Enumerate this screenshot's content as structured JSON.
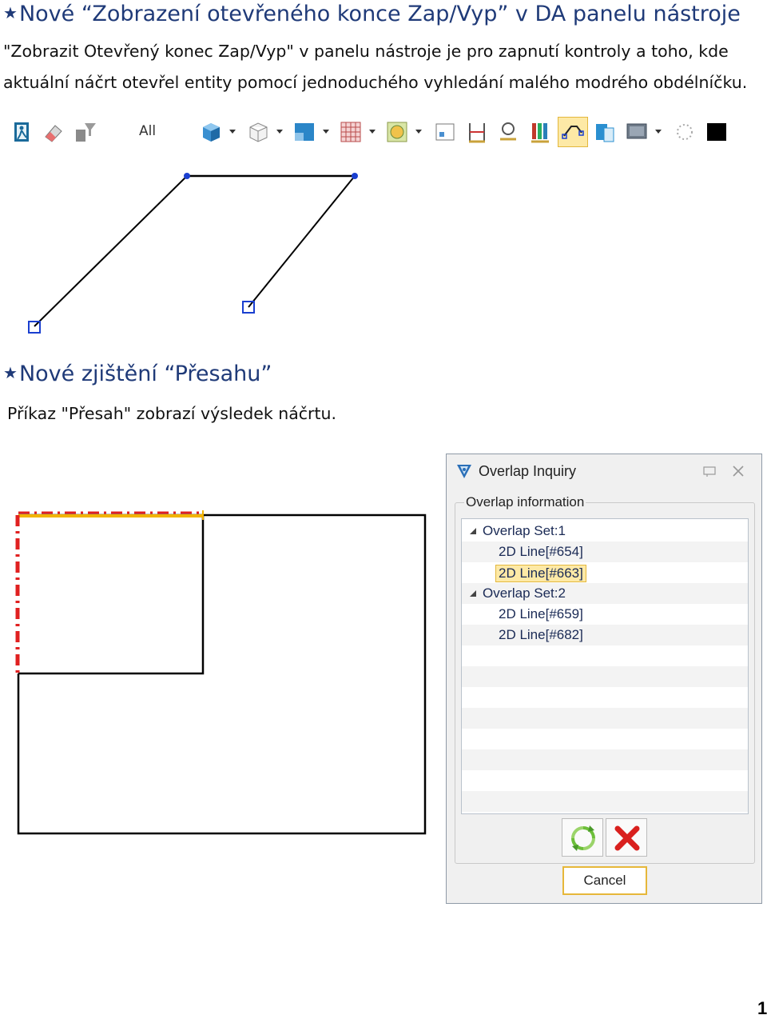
{
  "section1": {
    "heading": "Nové “Zobrazení otevřeného konce Zap/Vyp” v DA panelu nástroje",
    "line1": "\"Zobrazit Otevřený konec Zap/Vyp\" v panelu nástroje je pro zapnutí kontroly a toho, kde",
    "line2": "aktuální náčrt otevřel entity pomocí jednoduchého vyhledání malého modrého obdélníčku."
  },
  "toolbar": {
    "all_label": "All",
    "icons": [
      "exit-icon",
      "eraser-icon",
      "filter-icon",
      "shaded-cube-icon",
      "wireframe-cube-icon",
      "view-icon",
      "grid-icon",
      "render-icon",
      "frame-icon",
      "dimension-icon",
      "stamp-icon",
      "color-bars-icon",
      "open-end-icon",
      "book-icon",
      "monitor-icon",
      "dotted-circle-icon",
      "black-square-icon"
    ]
  },
  "section2": {
    "heading": "Nové zjištění “Přesahu”",
    "line1": "Příkaz \"Přesah\" zobrazí výsledek náčrtu."
  },
  "dialog": {
    "title": "Overlap Inquiry",
    "group_label": "Overlap information",
    "tree": [
      {
        "label": "Overlap Set:1",
        "level": 0
      },
      {
        "label": "2D Line[#654]",
        "level": 1
      },
      {
        "label": "2D Line[#663]",
        "level": 1,
        "selected": true
      },
      {
        "label": "Overlap Set:2",
        "level": 0
      },
      {
        "label": "2D Line[#659]",
        "level": 1
      },
      {
        "label": "2D Line[#682]",
        "level": 1
      }
    ],
    "cancel_label": "Cancel"
  },
  "page_number": "1"
}
